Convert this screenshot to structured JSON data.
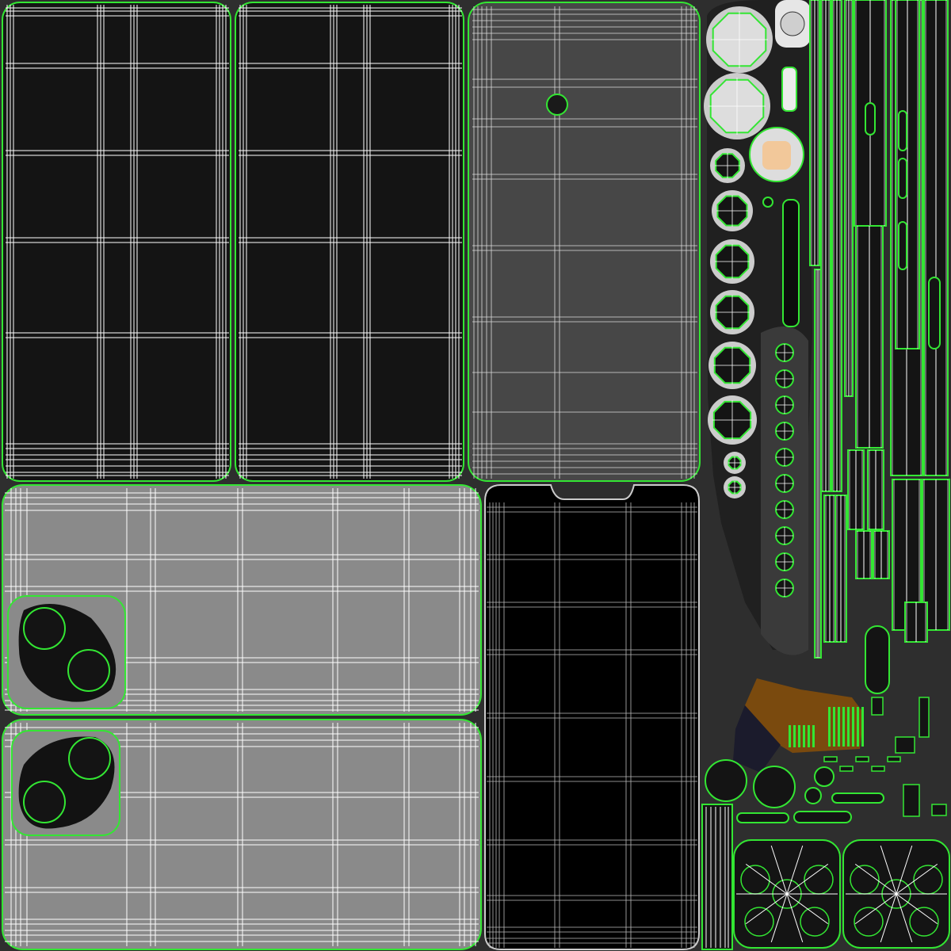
{
  "title": "",
  "colors": {
    "background": "#2e2e2e",
    "seam": "#33e633",
    "wire": "#ffffff",
    "panel_black": "#141414",
    "panel_dark_gray": "#474747",
    "panel_gray": "#8a8a8a",
    "screen_black": "#000000",
    "brown_patch": "#7a4a0e"
  },
  "uv_islands": [
    {
      "name": "back-panel-left",
      "icon": "rounded-rectangle"
    },
    {
      "name": "back-panel-middle",
      "icon": "rounded-rectangle"
    },
    {
      "name": "frame-panel-with-camera-hole",
      "icon": "rounded-rectangle"
    },
    {
      "name": "rear-glass-upper",
      "icon": "rounded-rectangle"
    },
    {
      "name": "rear-glass-lower",
      "icon": "rounded-rectangle"
    },
    {
      "name": "screen-panel-with-notch",
      "icon": "rounded-rectangle"
    },
    {
      "name": "button-and-lens-strip",
      "icon": "octagon"
    },
    {
      "name": "side-strips",
      "icon": "vertical-bar"
    },
    {
      "name": "bottom-camera-plates",
      "icon": "rounded-square"
    }
  ]
}
